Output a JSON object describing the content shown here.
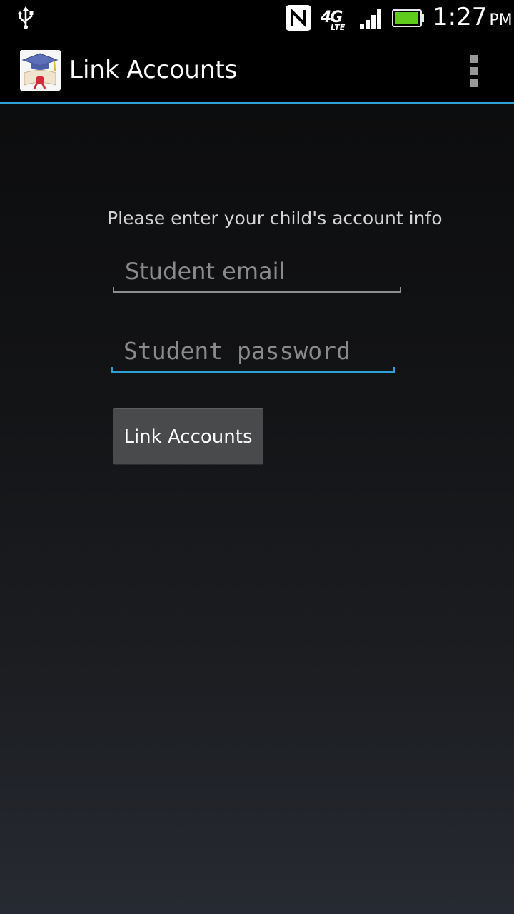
{
  "status_bar": {
    "time": "1:27",
    "ampm": "PM",
    "network_label": "4G",
    "network_sub_label": "LTE",
    "icons": [
      "usb-icon",
      "nfc-icon",
      "4g-lte-icon",
      "signal-icon",
      "battery-icon"
    ],
    "battery_level": 0.95
  },
  "action_bar": {
    "title": "Link Accounts",
    "app_icon": "graduation-cap-diploma-icon",
    "overflow_icon": "overflow-menu-icon",
    "accent_color": "#33a3d6"
  },
  "form": {
    "prompt": "Please enter your child's account info",
    "email": {
      "value": "",
      "placeholder": "Student email"
    },
    "password": {
      "value": "",
      "placeholder": "Student password",
      "focused": true
    },
    "submit_label": "Link Accounts"
  }
}
